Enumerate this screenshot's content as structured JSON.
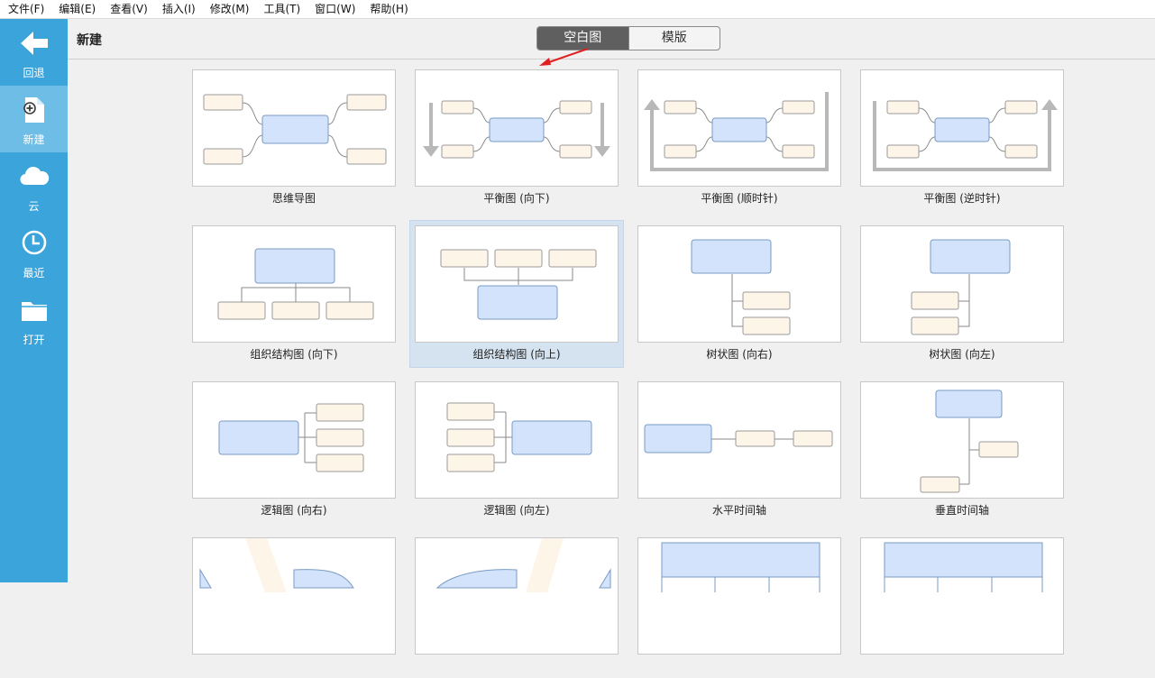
{
  "menu": [
    "文件(F)",
    "编辑(E)",
    "查看(V)",
    "插入(I)",
    "修改(M)",
    "工具(T)",
    "窗口(W)",
    "帮助(H)"
  ],
  "sidebar": {
    "items": [
      {
        "label": "回退",
        "icon": "back-arrow-icon"
      },
      {
        "label": "新建",
        "icon": "new-document-icon"
      },
      {
        "label": "云",
        "icon": "cloud-icon"
      },
      {
        "label": "最近",
        "icon": "clock-icon"
      },
      {
        "label": "打开",
        "icon": "folder-icon"
      }
    ],
    "active": 1
  },
  "header": {
    "title": "新建",
    "tabs": [
      "空白图",
      "模版"
    ],
    "active_tab": 0
  },
  "templates": [
    "思维导图",
    "平衡图 (向下)",
    "平衡图 (顺时针)",
    "平衡图 (逆时针)",
    "组织结构图 (向下)",
    "组织结构图 (向上)",
    "树状图 (向右)",
    "树状图 (向左)",
    "逻辑图 (向右)",
    "逻辑图 (向左)",
    "水平时间轴",
    "垂直时间轴",
    "",
    "",
    "",
    ""
  ],
  "selected_template": 5,
  "colors": {
    "sidebar": "#3aa4db",
    "sidebar_active": "#6dbde6",
    "topic_fill": "#d2e3fb",
    "subtopic_fill": "#fdf5e8",
    "annotation_arrow": "#e02020"
  }
}
